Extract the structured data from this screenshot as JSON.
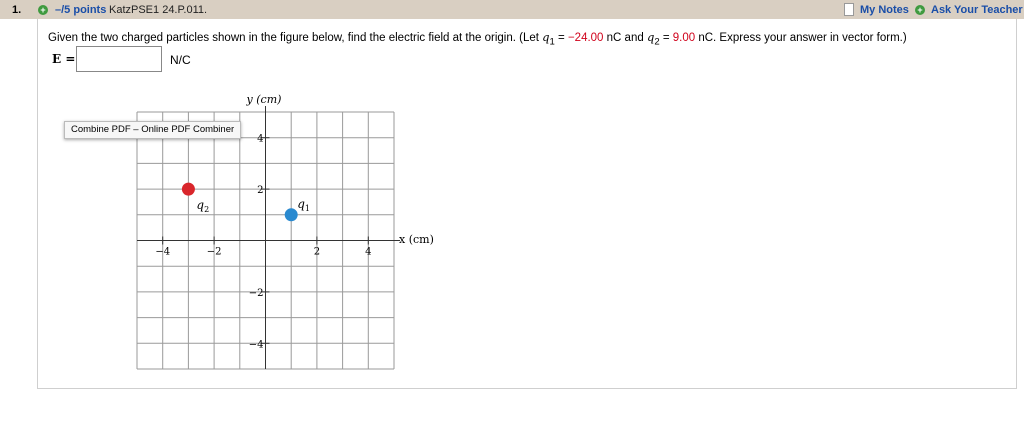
{
  "header": {
    "question_number": "1.",
    "points": "–/5 points",
    "problem_code": "KatzPSE1 24.P.011.",
    "my_notes": "My Notes",
    "ask_teacher": "Ask Your Teacher"
  },
  "question": {
    "text_before": "Given the two charged particles shown in the figure below, find the electric field at the origin. (Let ",
    "q1_sym": "q",
    "q1_sub": "1",
    "q1_eq": " = ",
    "q1_value": "−24.00",
    "q1_unit": " nC and ",
    "q2_sym": "q",
    "q2_sub": "2",
    "q2_eq": " = ",
    "q2_value": "9.00",
    "q2_unit": " nC. Express your answer in vector form.)",
    "red_color": "#d0021b"
  },
  "answer": {
    "label": "E =",
    "value": "",
    "unit": "N/C"
  },
  "tooltip": "Combine PDF – Online PDF Combiner",
  "figure": {
    "y_axis_label": "y (cm)",
    "x_axis_label": "x (cm)",
    "x_ticks": [
      "−4",
      "−2",
      "2",
      "4"
    ],
    "y_ticks": [
      "4",
      "2",
      "−2",
      "−4"
    ],
    "q1_label": "q1",
    "q2_label": "q2",
    "q1_color": "#2a8ad0",
    "q2_color": "#d9262b",
    "q1_x_cm": 1,
    "q1_y_cm": 1,
    "q2_x_cm": -3,
    "q2_y_cm": 2
  }
}
